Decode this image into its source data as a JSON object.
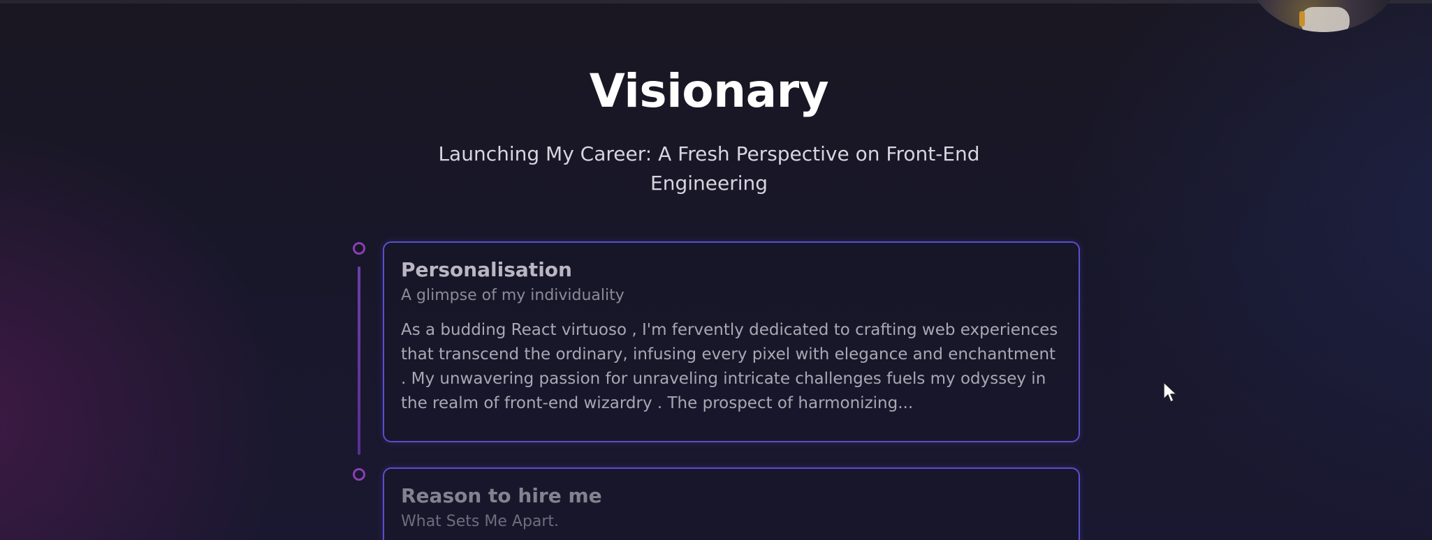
{
  "header": {
    "title": "Visionary",
    "subtitle": "Launching My Career: A Fresh Perspective on Front-End Engineering"
  },
  "timeline": {
    "cards": [
      {
        "title": "Personalisation",
        "tagline": "A glimpse of my individuality",
        "body": "As a budding React virtuoso , I'm fervently dedicated to crafting web experiences that transcend the ordinary, infusing every pixel with elegance and enchantment . My unwavering passion for unraveling intricate challenges fuels my odyssey in the realm of front-end wizardry . The prospect of harmonizing..."
      },
      {
        "title": "Reason to hire me",
        "tagline": "What Sets Me Apart."
      }
    ]
  },
  "colors": {
    "accent_border": "#5a4fd0",
    "timeline_dot": "#8a3fb4",
    "timeline_line": "#6d3ea8"
  },
  "icons": {
    "cursor": "mouse-pointer-icon",
    "avatar": "webcam-avatar"
  }
}
